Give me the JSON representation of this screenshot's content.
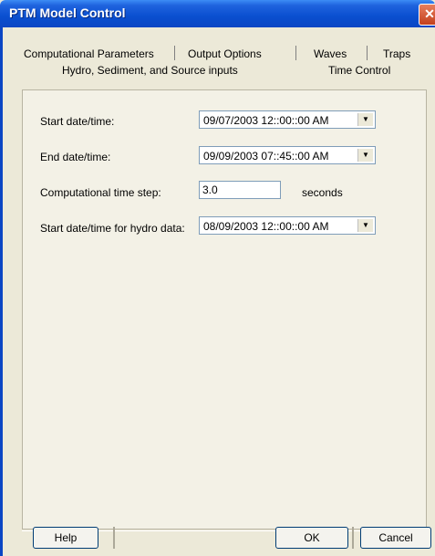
{
  "window": {
    "title": "PTM Model Control",
    "close_glyph": "✕"
  },
  "tabs": {
    "row1": [
      "Computational Parameters",
      "Output Options",
      "Waves",
      "Traps"
    ],
    "row2": [
      "Hydro, Sediment, and Source inputs",
      "Time Control"
    ],
    "active": "Time Control"
  },
  "form": {
    "start": {
      "label": "Start date/time:",
      "value": "09/07/2003  12::00::00 AM"
    },
    "end": {
      "label": "End date/time:",
      "value": "09/09/2003  07::45::00 AM"
    },
    "timestep": {
      "label": "Computational time step:",
      "value": "3.0",
      "unit": "seconds"
    },
    "hydro_start": {
      "label": "Start date/time for hydro data:",
      "value": "08/09/2003  12::00::00 AM"
    },
    "arrow_glyph": "▼"
  },
  "buttons": {
    "help": "Help",
    "ok": "OK",
    "cancel": "Cancel"
  }
}
